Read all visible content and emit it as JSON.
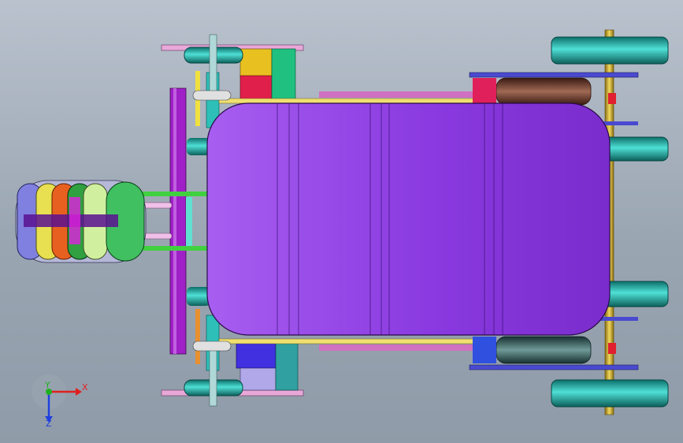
{
  "viewport": {
    "background_top": "#b9c2cd",
    "background_bottom": "#8f9ba8"
  },
  "model": {
    "body_color": "#9b45e8",
    "body_dark": "#7c2fd0",
    "rail_color": "#a020c8",
    "front_wheel_color": "#1fa6a0",
    "rear_wheel_color": "#0fb8b0",
    "spring_color_top": "#6b3a2a",
    "spring_color_bottom": "#2f5a5a",
    "axle_color": "#d4b020"
  },
  "triad": {
    "x_label": "X",
    "y_label": "Y",
    "z_label": "Z",
    "x_color": "#e02020",
    "y_color": "#20b020",
    "z_color": "#2040e0"
  }
}
